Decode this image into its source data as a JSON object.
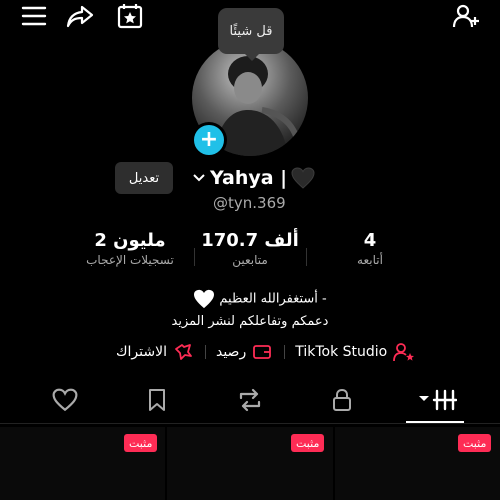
{
  "tooltip": {
    "text": "قل شيئًا"
  },
  "profile": {
    "edit_label": "تعديل",
    "name": "Yahya |",
    "handle": "@tyn.369"
  },
  "stats": [
    {
      "value": "2 مليون",
      "label": "تسجيلات الإعجاب"
    },
    {
      "value": "170.7 ألف",
      "label": "متابعين"
    },
    {
      "value": "4",
      "label": "أتابعه"
    }
  ],
  "bio": {
    "line1": "أستغفرالله العظيم -",
    "line2": "دعمكم وتفاعلكم لنشر المزيد"
  },
  "links": {
    "subscription": "الاشتراك",
    "balance": "رصيد",
    "studio": "TikTok Studio"
  },
  "pinned_badge": "مثبت",
  "colors": {
    "accent": "#fe2c55",
    "plus": "#20c0e8",
    "background": "#000000"
  }
}
